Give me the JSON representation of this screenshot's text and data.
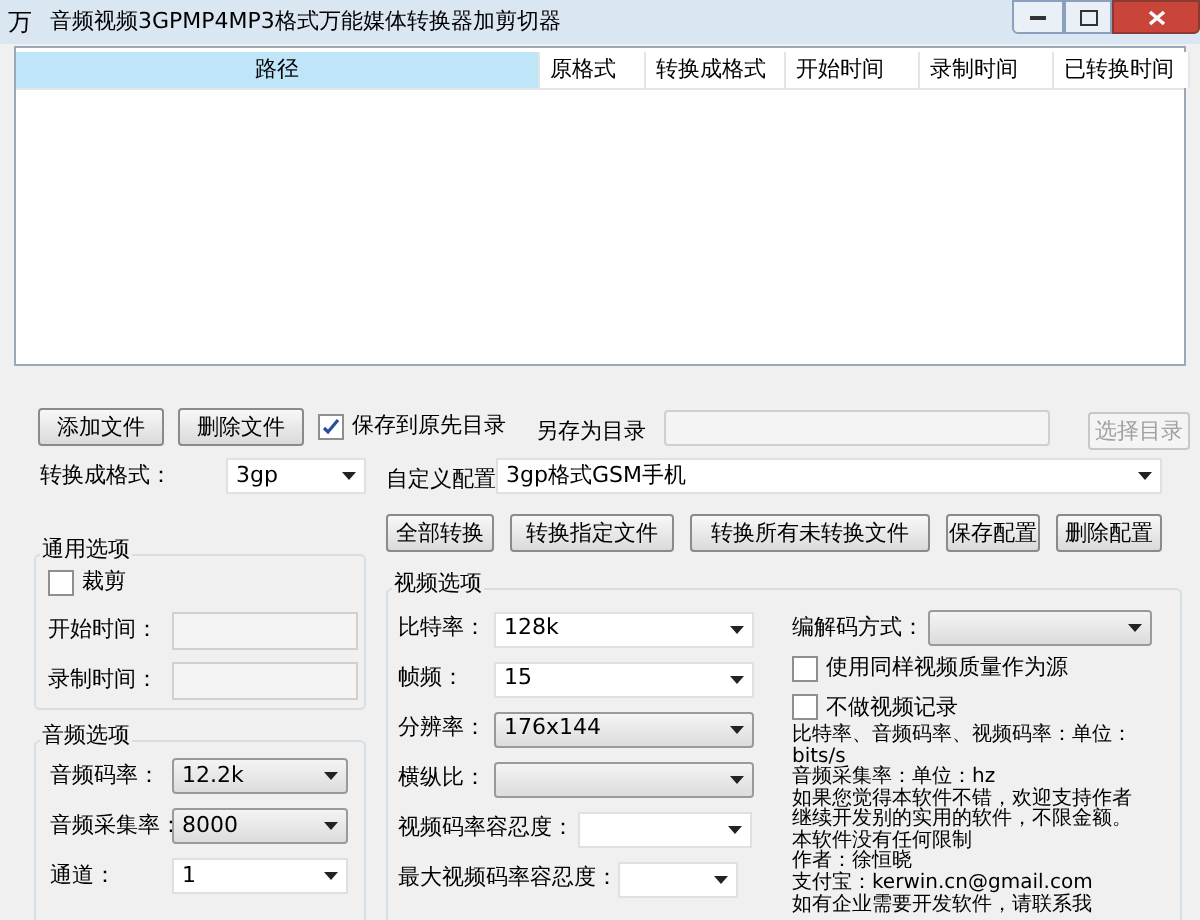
{
  "window": {
    "app_icon": "万",
    "title": "音频视频3GPMP4MP3格式万能媒体转换器加剪切器"
  },
  "table": {
    "columns": [
      {
        "label": "路径",
        "selected": true
      },
      {
        "label": "原格式",
        "selected": false
      },
      {
        "label": "转换成格式",
        "selected": false
      },
      {
        "label": "开始时间",
        "selected": false
      },
      {
        "label": "录制时间",
        "selected": false
      },
      {
        "label": "已转换时间",
        "selected": false
      }
    ]
  },
  "file_buttons": [
    "添加文件",
    "删除文件"
  ],
  "keep_dir": {
    "label": "保存到原先目录",
    "checked": true
  },
  "save_as": {
    "label": "另存为目录",
    "button": "选择目录",
    "disabled": true
  },
  "format": {
    "label": "转换成格式：",
    "value": "3gp"
  },
  "profile": {
    "label": "自定义配置",
    "value": "3gp格式GSM手机"
  },
  "actions": [
    "全部转换",
    "转换指定文件",
    "转换所有未转换文件",
    "保存配置",
    "删除配置"
  ],
  "general": {
    "title": "通用选项",
    "crop": {
      "label": "裁剪",
      "checked": false
    },
    "fields": [
      {
        "label": "开始时间："
      },
      {
        "label": "录制时间："
      }
    ]
  },
  "audio": {
    "title": "音频选项",
    "fields": [
      {
        "label": "音频码率：",
        "value": "12.2k"
      },
      {
        "label": "音频采集率：",
        "value": "8000"
      },
      {
        "label": "通道：",
        "value": "1"
      }
    ]
  },
  "video": {
    "title": "视频选项",
    "fields": [
      {
        "label": "比特率：",
        "value": "128k",
        "kind": "combo"
      },
      {
        "label": "帧频：",
        "value": "15",
        "kind": "combo"
      },
      {
        "label": "分辨率：",
        "value": "176x144",
        "kind": "list"
      },
      {
        "label": "横纵比：",
        "kind": "list"
      },
      {
        "label": "视频码率容忍度：",
        "kind": "combo"
      },
      {
        "label": "最大视频码率容忍度：",
        "kind": "combo"
      }
    ],
    "codec": {
      "label": "编解码方式："
    },
    "checks": [
      {
        "label": "使用同样视频质量作为源",
        "checked": false
      },
      {
        "label": "不做视频记录",
        "checked": false
      }
    ],
    "notes": [
      "比特率、音频码率、视频码率：单位：",
      "bits/s",
      "音频采集率：单位：hz",
      "如果您觉得本软件不错，欢迎支持作者",
      "继续开发别的实用的软件，不限金额。",
      "本软件没有任何限制",
      "作者：徐恒晓",
      "支付宝：kerwin.cn@gmail.com",
      "如有企业需要开发软件，请联系我"
    ]
  }
}
